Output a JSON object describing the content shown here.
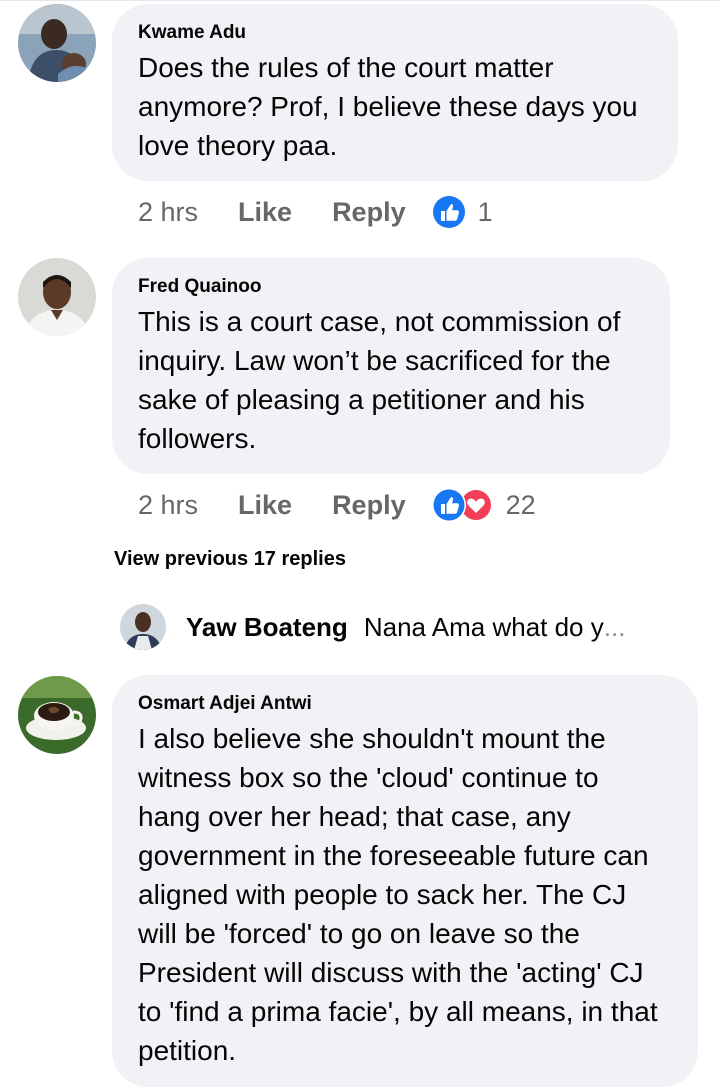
{
  "comments": [
    {
      "author": "Kwame Adu",
      "lines": [
        "Does the rules of the court  matter",
        "anymore? Prof, I  believe these days you",
        "love theory paa."
      ],
      "time": "2 hrs",
      "like_label": "Like",
      "reply_label": "Reply",
      "reaction_count": "1",
      "reactions": [
        "like-icon"
      ]
    },
    {
      "author": "Fred Quainoo",
      "lines": [
        "This is a court case, not commission of",
        "inquiry. Law won’t be sacrificed for the",
        "sake of pleasing a petitioner and his",
        "followers."
      ],
      "time": "2 hrs",
      "like_label": "Like",
      "reply_label": "Reply",
      "reaction_count": "22",
      "reactions": [
        "like-icon",
        "love-icon"
      ]
    },
    {
      "author": "Osmart Adjei Antwi",
      "lines": [
        "I also believe she shouldn't mount the",
        "witness box so the 'cloud' continue to",
        "hang over her head; that case, any",
        "government in the foreseeable future can",
        "aligned with people to sack her. The CJ",
        "will be 'forced' to go on leave so the",
        "President will discuss with the 'acting' CJ",
        "to 'find a prima facie', by all means, in that",
        "petition."
      ]
    }
  ],
  "view_previous": "View previous 17 replies",
  "reply_preview": {
    "author": "Yaw Boateng",
    "text": "Nana Ama what do y",
    "ellipsis": "..."
  },
  "colors": {
    "bubble": "#f0f2f5",
    "text": "#050505",
    "meta": "#65676b",
    "like_blue": "#1877f2",
    "love_red": "#f33e58"
  }
}
